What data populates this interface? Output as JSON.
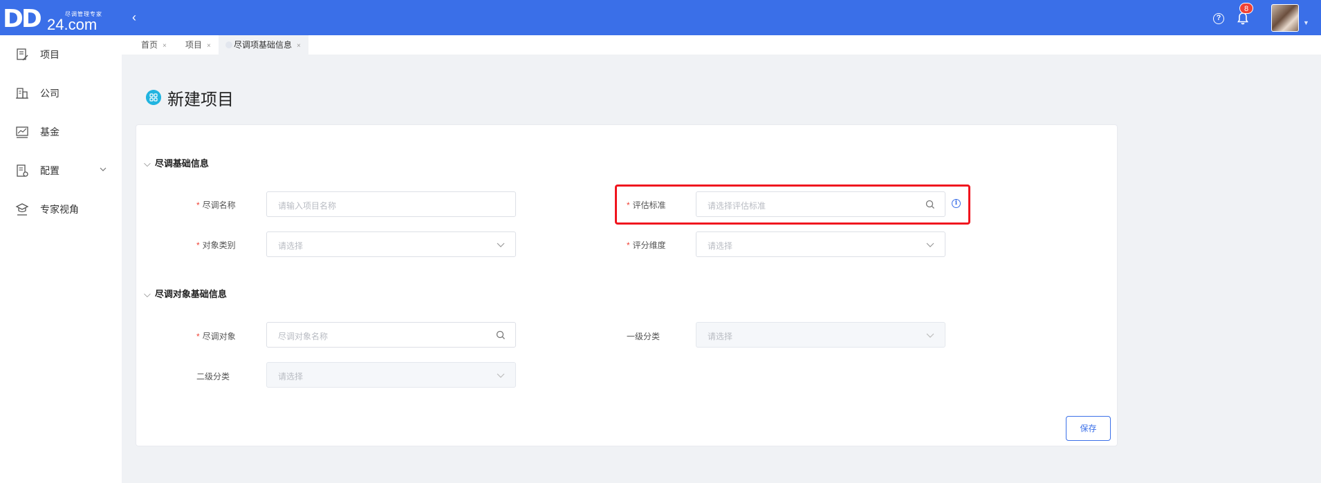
{
  "header": {
    "logo_main": "DD",
    "logo_domain": "24.com",
    "logo_tagline": "尽调管理专家",
    "notification_count": "8",
    "brand_color": "#3a6fe8"
  },
  "sidebar": {
    "items": [
      {
        "label": "项目",
        "icon": "document-edit-icon"
      },
      {
        "label": "公司",
        "icon": "building-icon"
      },
      {
        "label": "基金",
        "icon": "chart-line-icon"
      },
      {
        "label": "配置",
        "icon": "settings-doc-icon"
      },
      {
        "label": "专家视角",
        "icon": "expert-icon"
      }
    ]
  },
  "tabs": [
    {
      "label": "首页"
    },
    {
      "label": "项目"
    },
    {
      "label": "尽调项基础信息",
      "active": true
    }
  ],
  "page": {
    "title": "新建项目"
  },
  "sections": {
    "basic": {
      "title": "尽调基础信息",
      "fields": {
        "name": {
          "label": "尽调名称",
          "placeholder": "请输入项目名称"
        },
        "standard": {
          "label": "评估标准",
          "placeholder": "请选择评估标准"
        },
        "category": {
          "label": "对象类别",
          "placeholder": "请选择"
        },
        "dimension": {
          "label": "评分维度",
          "placeholder": "请选择"
        }
      }
    },
    "object": {
      "title": "尽调对象基础信息",
      "fields": {
        "target": {
          "label": "尽调对象",
          "placeholder": "尽调对象名称"
        },
        "level1": {
          "label": "一级分类",
          "placeholder": "请选择"
        },
        "level2": {
          "label": "二级分类",
          "placeholder": "请选择"
        }
      }
    }
  },
  "required_mark": "*",
  "actions": {
    "save_label": "保存"
  }
}
